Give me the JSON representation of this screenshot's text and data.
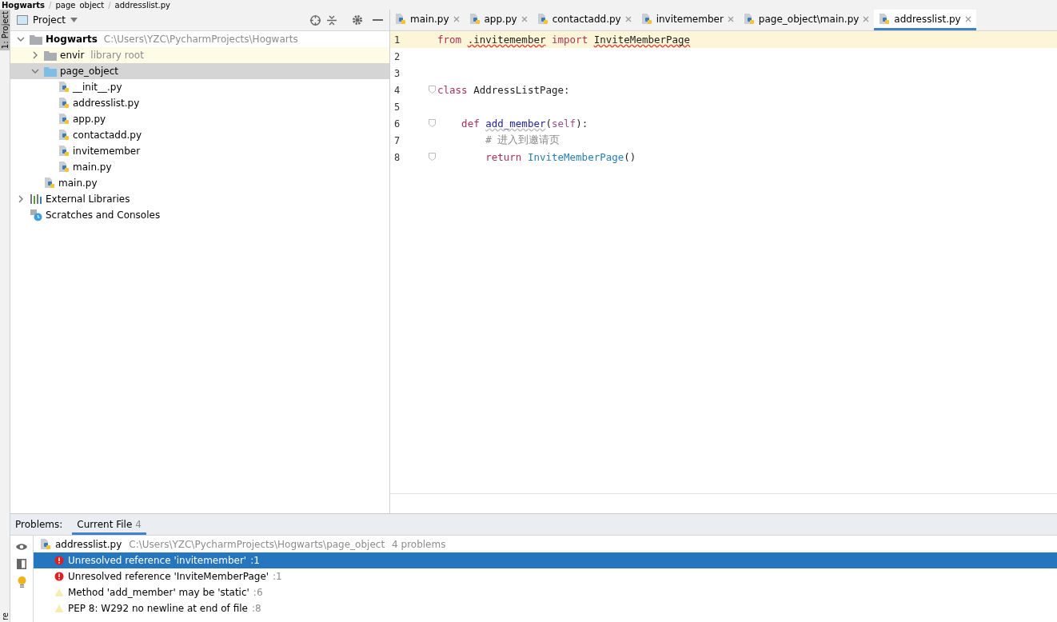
{
  "breadcrumb": [
    {
      "label": "Hogwarts"
    },
    {
      "separator": "/",
      "label": "page_object"
    },
    {
      "separator": "/",
      "label": "addresslist.py"
    }
  ],
  "side_strip": {
    "top_tab": "1: Project",
    "bottom_tab": "re"
  },
  "project_panel": {
    "title": "Project",
    "tree": [
      {
        "label": "Hogwarts",
        "hint": "C:\\Users\\YZC\\PycharmProjects\\Hogwarts",
        "kind": "folder",
        "expanded": true,
        "selected": false,
        "highlighted": false,
        "children": [
          {
            "label": "envir",
            "hint": "library root",
            "kind": "folder",
            "expanded": false,
            "selected": false,
            "highlighted": true
          },
          {
            "label": "page_object",
            "kind": "package",
            "expanded": true,
            "selected": true,
            "highlighted": false,
            "children": [
              {
                "label": "__init__.py",
                "kind": "python",
                "selected": false,
                "highlighted": false
              },
              {
                "label": "addresslist.py",
                "kind": "python",
                "selected": false,
                "highlighted": false
              },
              {
                "label": "app.py",
                "kind": "python",
                "selected": false,
                "highlighted": false
              },
              {
                "label": "contactadd.py",
                "kind": "python",
                "selected": false,
                "highlighted": false
              },
              {
                "label": "invitemember",
                "kind": "python",
                "selected": false,
                "highlighted": false
              },
              {
                "label": "main.py",
                "kind": "python",
                "selected": false,
                "highlighted": false
              }
            ]
          },
          {
            "label": "main.py",
            "kind": "python",
            "selected": false,
            "highlighted": false
          }
        ]
      },
      {
        "label": "External Libraries",
        "kind": "libraries",
        "expanded": false,
        "selected": false,
        "highlighted": false
      },
      {
        "label": "Scratches and Consoles",
        "kind": "scratches",
        "selected": false,
        "highlighted": false
      }
    ]
  },
  "editor": {
    "tabs": [
      {
        "label": "main.py",
        "selected": false
      },
      {
        "label": "app.py",
        "selected": false
      },
      {
        "label": "contactadd.py",
        "selected": false
      },
      {
        "label": "invitemember",
        "selected": false
      },
      {
        "label": "page_object\\main.py",
        "selected": false
      },
      {
        "label": "addresslist.py",
        "selected": true
      }
    ],
    "lines": [
      {
        "number": "1",
        "current": true,
        "tokens": [
          {
            "text": "from ",
            "kind": "keyword"
          },
          {
            "text": ".invitemember",
            "kind": "error"
          },
          {
            "text": " import ",
            "kind": "keyword"
          },
          {
            "text": "InviteMemberPage",
            "kind": "error"
          }
        ]
      },
      {
        "number": "2",
        "current": false
      },
      {
        "number": "3",
        "current": false
      },
      {
        "number": "4",
        "current": false,
        "fold": true,
        "tokens": [
          {
            "text": "class",
            "kind": "keyword"
          },
          {
            "text": " AddressListPage:"
          }
        ]
      },
      {
        "number": "5",
        "current": false
      },
      {
        "number": "6",
        "current": false,
        "fold": true,
        "tokens": [
          {
            "text": "    def ",
            "kind": "keyword"
          },
          {
            "text": "add_member",
            "kind": "function"
          },
          {
            "text": "("
          },
          {
            "text": "self",
            "kind": "self"
          },
          {
            "text": "):"
          }
        ]
      },
      {
        "number": "7",
        "current": false,
        "tokens": [
          {
            "text": "        # 进入到邀请页",
            "kind": "comment"
          }
        ]
      },
      {
        "number": "8",
        "current": false,
        "fold": true,
        "tokens": [
          {
            "text": "        return ",
            "kind": "keyword"
          },
          {
            "text": "InviteMemberPage",
            "kind": "call"
          },
          {
            "text": "()"
          }
        ]
      }
    ]
  },
  "problems": {
    "label": "Problems:",
    "tabs": [
      {
        "label": "Current File",
        "count": "4",
        "selected": true
      }
    ],
    "file": {
      "name": "addresslist.py",
      "path": "C:\\Users\\YZC\\PycharmProjects\\Hogwarts\\page_object",
      "summary": "4 problems"
    },
    "items": [
      {
        "kind": "error",
        "text": "Unresolved reference 'invitemember'",
        "line": ":1",
        "selected": true
      },
      {
        "kind": "error",
        "text": "Unresolved reference 'InviteMemberPage'",
        "line": ":1",
        "selected": false
      },
      {
        "kind": "warning",
        "text": "Method 'add_member' may be 'static'",
        "line": ":6",
        "selected": false
      },
      {
        "kind": "warning",
        "text": "PEP 8: W292 no newline at end of file",
        "line": ":8",
        "selected": false
      }
    ]
  }
}
